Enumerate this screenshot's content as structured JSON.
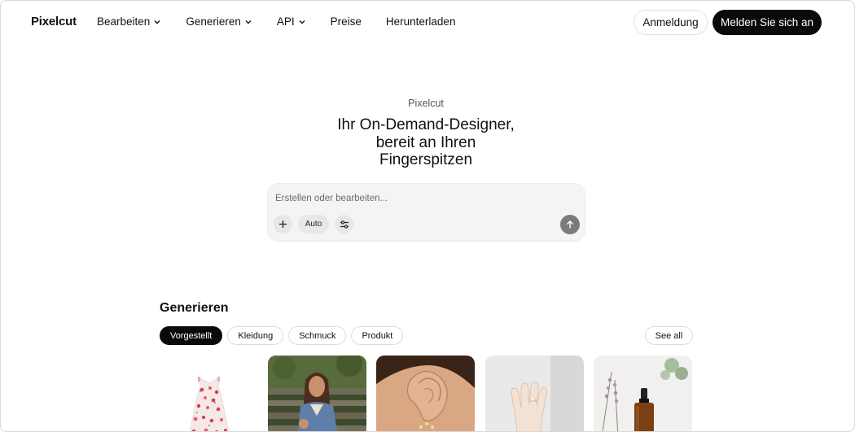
{
  "header": {
    "logo": "Pixelcut",
    "menu": [
      {
        "label": "Bearbeiten",
        "has_dropdown": true
      },
      {
        "label": "Generieren",
        "has_dropdown": true
      },
      {
        "label": "API",
        "has_dropdown": true
      },
      {
        "label": "Preise",
        "has_dropdown": false
      },
      {
        "label": "Herunterladen",
        "has_dropdown": false
      }
    ],
    "login_label": "Anmeldung",
    "signup_label": "Melden Sie sich an"
  },
  "hero": {
    "eyebrow": "Pixelcut",
    "title_lines": [
      "Ihr On-Demand-Designer,",
      "bereit an Ihren",
      "Fingerspitzen"
    ]
  },
  "prompt": {
    "placeholder": "Erstellen oder bearbeiten...",
    "value": "",
    "plus_icon": "plus-icon",
    "mode_label": "Auto",
    "settings_icon": "sliders-icon",
    "send_icon": "arrow-up-icon"
  },
  "generate": {
    "title": "Generieren",
    "chips": [
      {
        "label": "Vorgestellt",
        "active": true
      },
      {
        "label": "Kleidung",
        "active": false
      },
      {
        "label": "Schmuck",
        "active": false
      },
      {
        "label": "Produkt",
        "active": false
      }
    ],
    "see_all_label": "See all",
    "cards": [
      {
        "subject": "floral-dress-image"
      },
      {
        "subject": "woman-denim-jacket-image"
      },
      {
        "subject": "ear-earring-image"
      },
      {
        "subject": "hand-ring-image"
      },
      {
        "subject": "serum-bottle-lavender-image"
      }
    ]
  },
  "colors": {
    "accent": "#0a0a0a",
    "prompt_bg": "#f4f4f4",
    "send_button": "#7b7b7b"
  }
}
